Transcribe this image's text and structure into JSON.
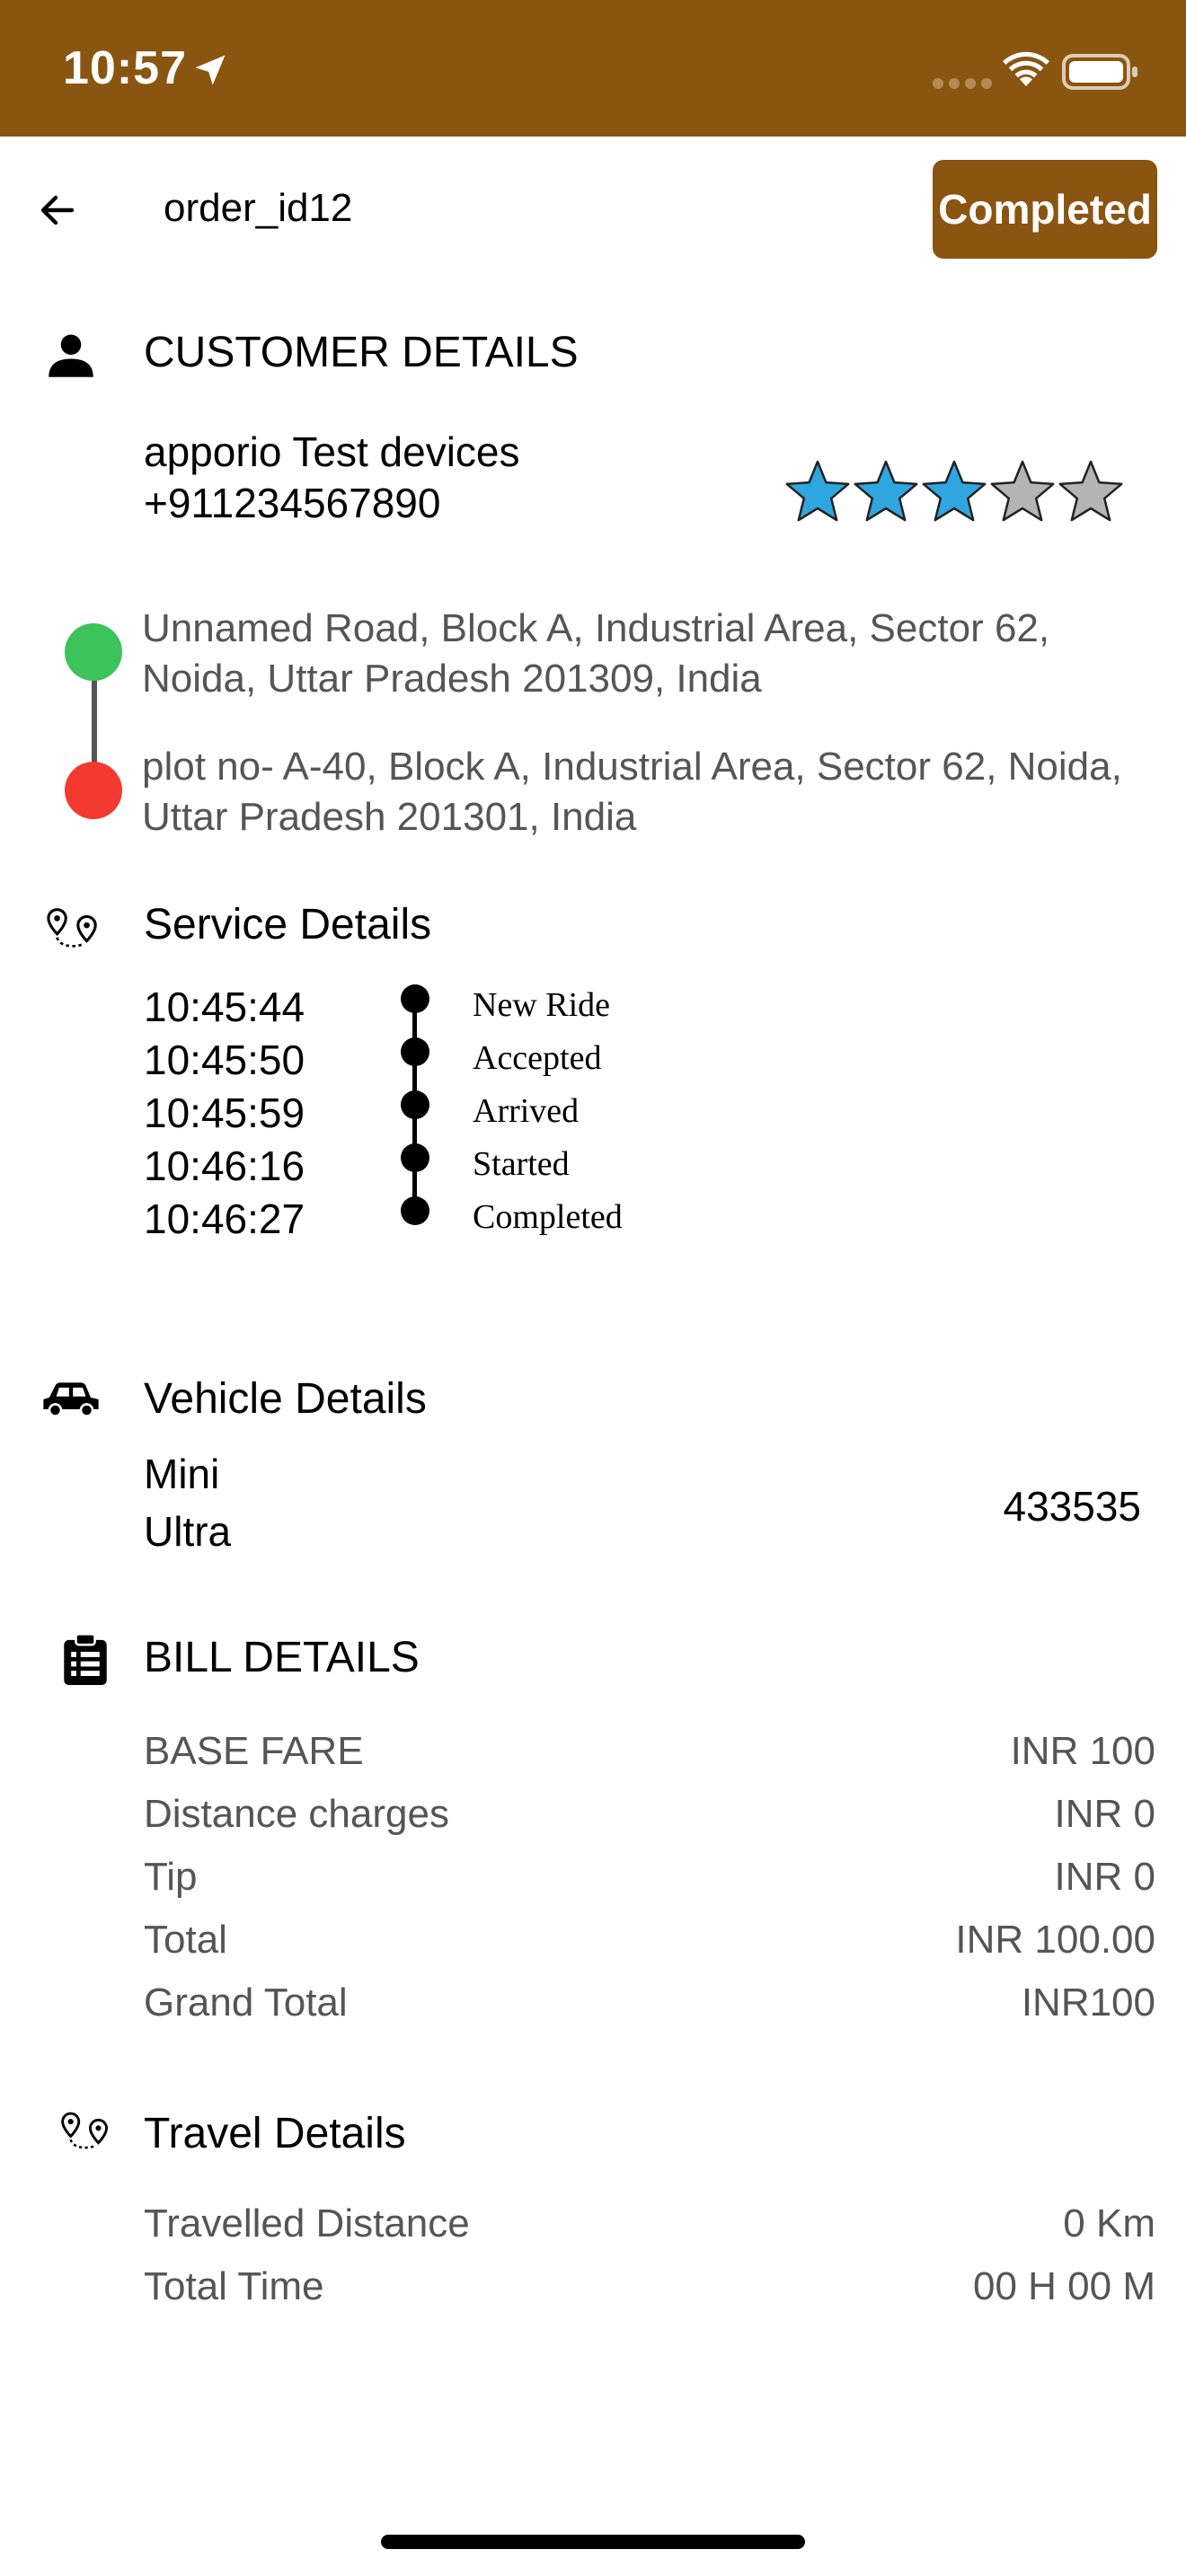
{
  "status_bar": {
    "time": "10:57",
    "icons": [
      "location-arrow-icon",
      "cellular-dots-icon",
      "wifi-icon",
      "battery-icon"
    ]
  },
  "header": {
    "order_id": "order_id12",
    "status": "Completed",
    "back_icon": "arrow-left-icon"
  },
  "customer": {
    "section_title": "CUSTOMER DETAILS",
    "name": "apporio Test devices",
    "phone": "+911234567890",
    "rating": 3,
    "rating_max": 5
  },
  "addresses": {
    "pickup": "Unnamed Road, Block A, Industrial Area, Sector 62, Noida, Uttar Pradesh 201309, India",
    "drop": "plot no- A-40, Block A, Industrial Area, Sector 62, Noida, Uttar Pradesh 201301, India"
  },
  "service": {
    "section_title": "Service Details",
    "timeline": [
      {
        "time": "10:45:44",
        "status": "New Ride"
      },
      {
        "time": "10:45:50",
        "status": "Accepted"
      },
      {
        "time": "10:45:59",
        "status": "Arrived"
      },
      {
        "time": "10:46:16",
        "status": "Started"
      },
      {
        "time": "10:46:27",
        "status": "Completed"
      }
    ]
  },
  "vehicle": {
    "section_title": "Vehicle Details",
    "type": "Mini",
    "model": "Ultra",
    "number": "433535"
  },
  "bill": {
    "section_title": "BILL DETAILS",
    "rows": [
      {
        "label": "BASE FARE",
        "value": "INR 100"
      },
      {
        "label": "Distance charges",
        "value": "INR 0"
      },
      {
        "label": "Tip",
        "value": "INR 0"
      },
      {
        "label": "Total",
        "value": "INR 100.00"
      },
      {
        "label": "Grand Total",
        "value": "INR100"
      }
    ]
  },
  "travel": {
    "section_title": "Travel Details",
    "rows": [
      {
        "label": "Travelled Distance",
        "value": "0 Km"
      },
      {
        "label": "Total Time",
        "value": "00 H 00 M"
      }
    ]
  },
  "colors": {
    "brand": "#8a5510",
    "star_filled": "#2fa6e0",
    "star_empty": "#b4b4b4",
    "pickup_dot": "#3cc35a",
    "drop_dot": "#f33a30",
    "muted_text": "#555555"
  }
}
